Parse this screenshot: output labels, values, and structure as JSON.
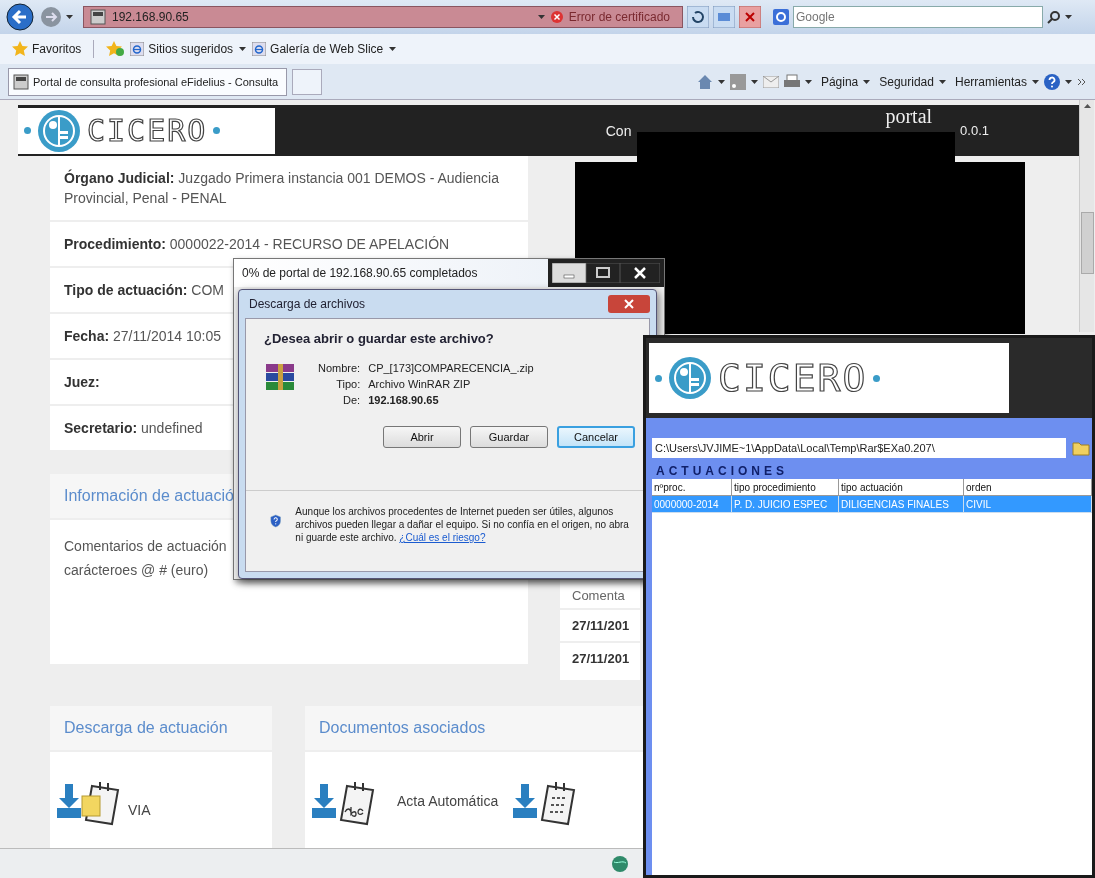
{
  "browser": {
    "address": "192.168.90.65",
    "certificate_warning": "Error de certificado",
    "search_placeholder": "Google",
    "favorites": {
      "label": "Favoritos",
      "links": [
        "Sitios sugeridos",
        "Galería de Web Slice"
      ]
    },
    "tab": {
      "title": "Portal de consulta profesional eFidelius - Consulta"
    },
    "command_bar": [
      "Página",
      "Seguridad",
      "Herramientas"
    ]
  },
  "page": {
    "header": {
      "logo": "CICERO",
      "nav_text": "Con",
      "portal": "portal",
      "version": "0.0.1"
    },
    "details": [
      {
        "label": "Órgano Judicial:",
        "value": "Juzgado Primera instancia 001 DEMOS - Audiencia Provincial, Penal - PENAL"
      },
      {
        "label": "Procedimiento:",
        "value": "0000022-2014 - RECURSO DE APELACIÓN"
      },
      {
        "label": "Tipo de actuación:",
        "value": "COM"
      },
      {
        "label": "Fecha:",
        "value": "27/11/2014 10:05"
      },
      {
        "label": "Juez:"
      },
      {
        "label": "Secretario:",
        "value": "undefined"
      }
    ],
    "info_card": {
      "title": "Información de actuació",
      "lines": [
        "Comentarios de actuación",
        "carácteroes @ # (euro)"
      ]
    },
    "side_card": {
      "title": "Comenta",
      "rows": [
        "27/11/201",
        "27/11/201"
      ]
    },
    "download_card": {
      "title": "Descarga de actuación",
      "items": [
        {
          "kind": "package",
          "label": "VIA"
        }
      ]
    },
    "documents_card": {
      "title": "Documentos asociados",
      "items": [
        {
          "kind": "text",
          "label": "Acta Automática"
        },
        {
          "kind": "grid"
        }
      ]
    }
  },
  "progress_window": {
    "title": "0% de portal de 192.168.90.65 completados"
  },
  "download_dialog": {
    "title": "Descarga de archivos",
    "question": "¿Desea abrir o guardar este archivo?",
    "fields": [
      {
        "label": "Nombre:",
        "value": "CP_[173]COMPARECENCIA_.zip",
        "bold": false
      },
      {
        "label": "Tipo:",
        "value": "Archivo WinRAR ZIP",
        "bold": false
      },
      {
        "label": "De:",
        "value": "192.168.90.65",
        "bold": true
      }
    ],
    "buttons": [
      {
        "label": "Abrir",
        "default": false
      },
      {
        "label": "Guardar",
        "default": false
      },
      {
        "label": "Cancelar",
        "default": true
      }
    ],
    "warning": "Aunque los archivos procedentes de Internet pueden ser útiles, algunos archivos pueden llegar a dañar el equipo. Si no confía en el origen, no abra ni guarde este archivo.",
    "warning_link": "¿Cuál es el riesgo?"
  },
  "cicero_window": {
    "logo": "CICERO",
    "path": "C:\\Users\\JVJIME~1\\AppData\\Local\\Temp\\Rar$EXa0.207\\",
    "heading": "ACTUACIONES",
    "columns": [
      "nºproc.",
      "tipo procedimiento",
      "tipo actuación",
      "orden"
    ],
    "rows": [
      {
        "cells": [
          "0000000-2014",
          "P. D. JUICIO ESPEC",
          "DILIGENCIAS FINALES",
          "CIVIL"
        ],
        "selected": true
      }
    ]
  }
}
